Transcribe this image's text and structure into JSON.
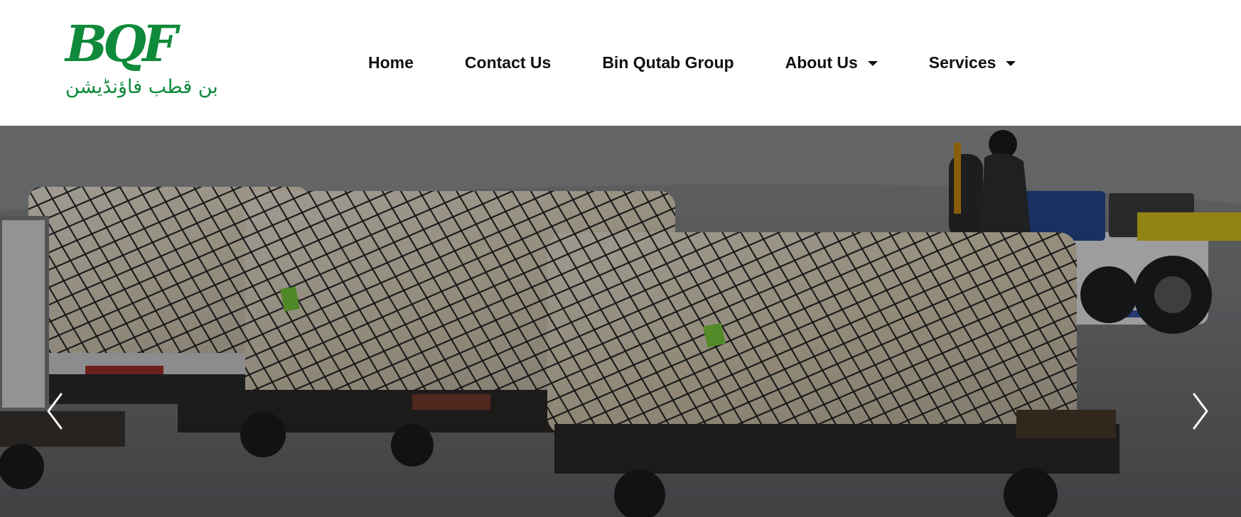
{
  "brand": {
    "logo_text": "BQF",
    "logo_subtitle": "بن قطب فاؤنڈیشن",
    "color": "#0f8a3a"
  },
  "nav": {
    "items": [
      {
        "label": "Home",
        "dropdown": false
      },
      {
        "label": "Contact Us",
        "dropdown": false
      },
      {
        "label": "Bin Qutab Group",
        "dropdown": false
      },
      {
        "label": "About Us",
        "dropdown": true
      },
      {
        "label": "Services",
        "dropdown": true
      }
    ]
  },
  "hero": {
    "icons": {
      "prev": "chevron-left-icon",
      "next": "chevron-right-icon"
    }
  }
}
